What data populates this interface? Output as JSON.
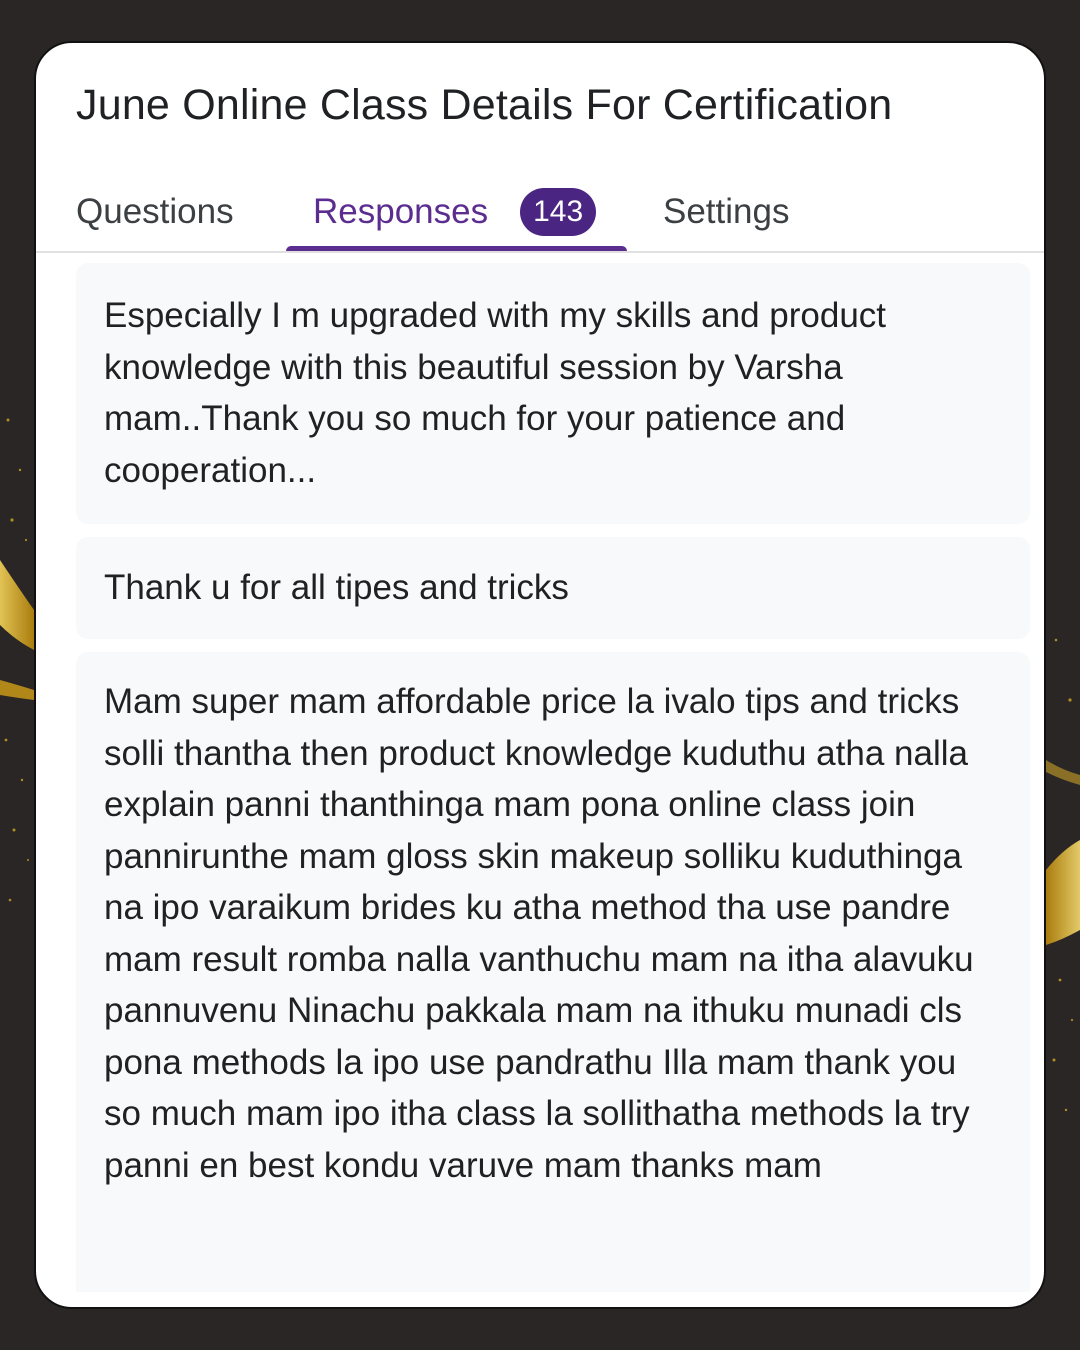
{
  "form": {
    "title": "June Online Class Details For Certification"
  },
  "tabs": {
    "questions": "Questions",
    "responses": "Responses",
    "responses_count": "143",
    "settings": "Settings"
  },
  "responses": [
    {
      "text": "Especially I m upgraded with my skills and product knowledge with this beautiful session by Varsha mam..Thank you so much for your patience and cooperation..."
    },
    {
      "text": "Thank u for all tipes and tricks"
    },
    {
      "text": "Mam super mam affordable price la ivalo tips and tricks solli thantha then product knowledge kuduthu atha nalla explain panni thanthinga mam pona online class join pannirunthe mam gloss skin makeup solliku kuduthinga na ipo varaikum brides ku atha method tha use pandre mam result romba nalla vanthuchu mam na itha alavuku pannuvenu Ninachu pakkala mam na ithuku munadi cls pona methods la ipo use pandrathu Illa mam thank you so much mam ipo itha class la sollithatha methods la try panni en best kondu varuve mam thanks mam"
    }
  ],
  "colors": {
    "accent": "#5b2d8f",
    "badge": "#4a2682",
    "background": "#2a2626",
    "card": "#ffffff",
    "response_bg": "#f8f9fa",
    "gold": "#e8b923"
  }
}
